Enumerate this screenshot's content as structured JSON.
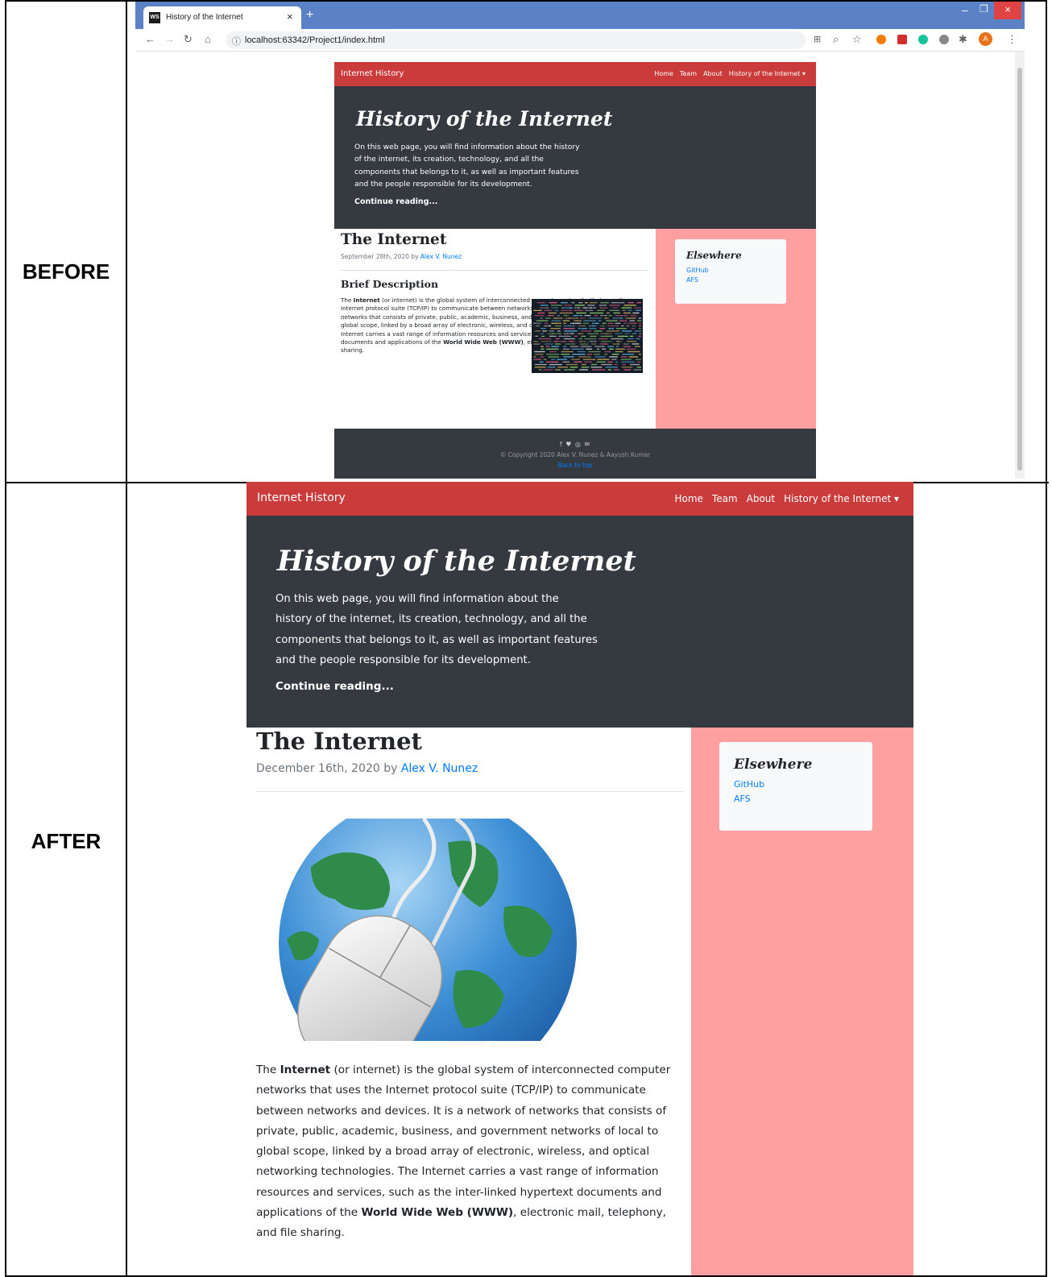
{
  "labels": {
    "before": "BEFORE",
    "after": "AFTER"
  },
  "browser": {
    "tab_title": "History of the Internet",
    "tab_favicon": "WS",
    "tab_close": "×",
    "new_tab": "+",
    "url": "localhost:63342/Project1/index.html",
    "profile_initial": "A",
    "window_minimize": "–",
    "window_restore": "❐",
    "window_close": "×"
  },
  "site": {
    "brand": "Internet History",
    "nav": [
      "Home",
      "Team",
      "About",
      "History of the Internet ▾"
    ],
    "hero": {
      "title": "History of the Internet",
      "text": "On this web page, you will find information about the history of the internet, its creation, technology, and all the components that belongs to it, as well as important features and the people responsible for its development.",
      "link": "Continue reading..."
    },
    "sidebar": {
      "title": "Elsewhere",
      "links": [
        "GitHub",
        "AFS"
      ]
    },
    "post_title": "The Internet",
    "post_by": " by ",
    "author": "Alex V. Nunez",
    "body": {
      "p1": "The ",
      "b1": "Internet",
      "p2": " (or internet) is the global system of interconnected computer networks that uses the Internet protocol suite (TCP/IP) to communicate between networks and devices. It is a network of networks that consists of private, public, academic, business, and government networks of local to global scope, linked by a broad array of electronic, wireless, and optical networking technologies. The Internet carries a vast range of information resources and services, such as the inter-linked hypertext documents and applications of the ",
      "b2": "World Wide Web (WWW)",
      "p3": ", electronic mail, telephony, and file sharing."
    }
  },
  "before": {
    "post_date": "September 28th, 2020",
    "subheading": "Brief Description",
    "footer": {
      "social": "f ♥ ◎ ✉",
      "copyright": "© Copyright 2020 Alex V. Nunez & Aayush Kumar",
      "back_to_top": "Back to top"
    }
  },
  "after": {
    "post_date": "December 16th, 2020"
  },
  "colors": {
    "navbar": "#ca3b3b",
    "hero": "#343a40",
    "sidebar": "#ff9f9f",
    "link": "#007bff",
    "tabbar": "#5b82c7"
  }
}
